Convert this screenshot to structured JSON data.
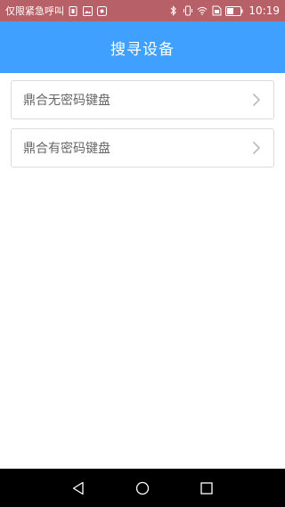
{
  "status_bar": {
    "carrier_text": "仅限紧急呼叫",
    "time": "10:19",
    "icons_left": [
      "sim-icon",
      "image-icon",
      "message-icon"
    ],
    "icons_right": [
      "bluetooth-icon",
      "vibrate-icon",
      "wifi-icon",
      "sim-card-icon",
      "battery-icon"
    ]
  },
  "app_bar": {
    "title": "搜寻设备",
    "color": "#3fa0ff"
  },
  "device_list": {
    "items": [
      {
        "label": "鼎合无密码键盘"
      },
      {
        "label": "鼎合有密码键盘"
      }
    ]
  },
  "nav_bar": {
    "buttons": [
      "back-icon",
      "home-icon",
      "recents-icon"
    ]
  }
}
